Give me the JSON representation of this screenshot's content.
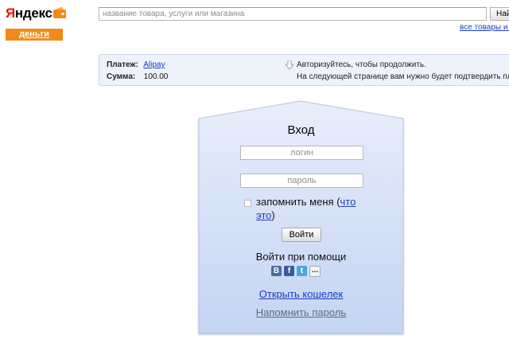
{
  "logo": {
    "first_letter": "Я",
    "rest": "ндекс",
    "sub": "деньги"
  },
  "search": {
    "placeholder": "название товара, услуги или магазина",
    "button_label": "Най",
    "all_goods_link": "все товары и у"
  },
  "payment": {
    "payment_label": "Платеж:",
    "payment_value": "Alipay",
    "sum_label": "Сумма:",
    "sum_value": "100.00",
    "notice_1": "Авторизуйтесь, чтобы продолжить.",
    "notice_2": "На следующей странице вам нужно будет подтвердить платеж"
  },
  "login": {
    "title": "Вход",
    "login_placeholder": "логин",
    "password_placeholder": "пароль",
    "remember_label": "запомнить меня",
    "remember_paren_open": " (",
    "remember_link": "что это",
    "remember_paren_close": ")",
    "submit_label": "Войти",
    "social_title": "Войти при помощи",
    "social": [
      {
        "name": "vk",
        "glyph": "В",
        "color": "#4b6c9a"
      },
      {
        "name": "facebook",
        "glyph": "f",
        "color": "#3a5a9c"
      },
      {
        "name": "twitter",
        "glyph": "t",
        "color": "#46a8dd"
      },
      {
        "name": "more",
        "glyph": "..."
      }
    ],
    "open_wallet": "Открыть кошелек",
    "remind_password": "Напомнить пароль"
  },
  "colors": {
    "brand_red": "#e61400",
    "money_orange": "#f28a1a",
    "link_blue": "#1a3dc1",
    "panel_blue": "#c9d8f5"
  }
}
